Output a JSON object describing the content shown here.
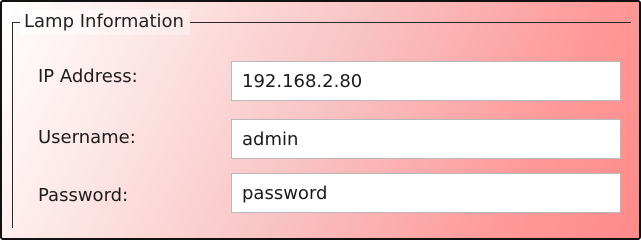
{
  "group": {
    "title": "Lamp Information"
  },
  "form": {
    "ip_label": "IP Address:",
    "ip_value": "192.168.2.80",
    "username_label": "Username:",
    "username_value": "admin",
    "password_label": "Password:",
    "password_value": "password"
  },
  "colors": {
    "gradient_start": "#ffffff",
    "gradient_end": "#ff8a8a",
    "border": "#111111"
  }
}
